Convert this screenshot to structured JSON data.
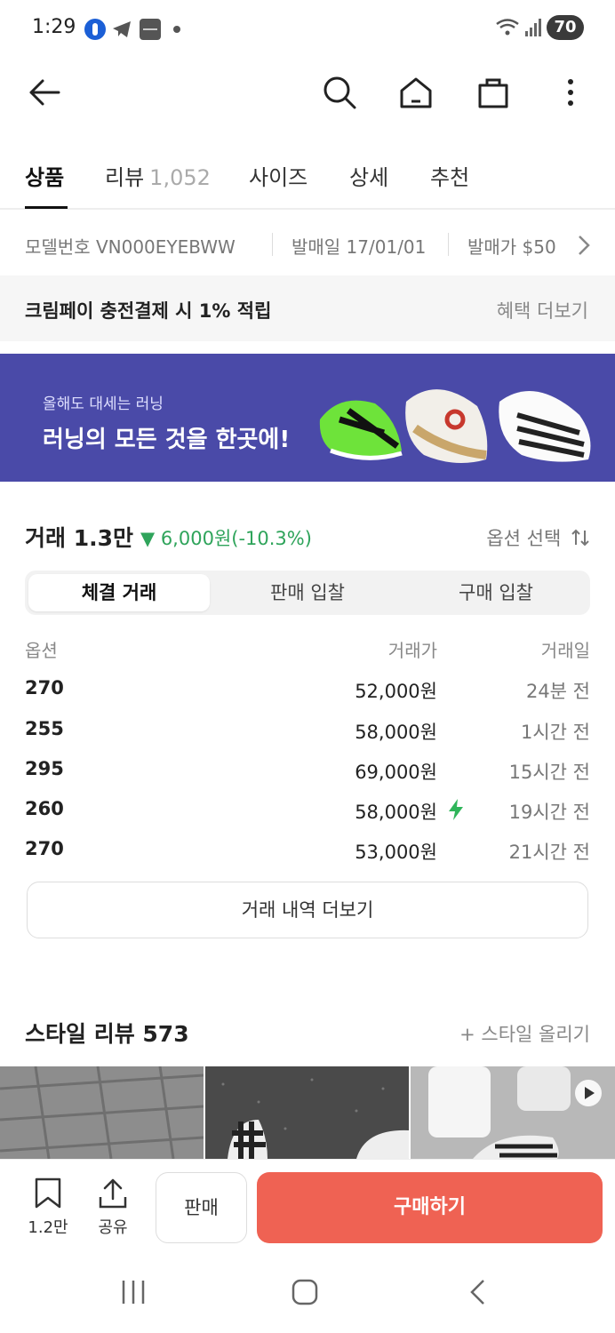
{
  "status_bar": {
    "time": "1:29",
    "battery": "70"
  },
  "tabs": [
    {
      "label": "상품",
      "count": ""
    },
    {
      "label": "리뷰",
      "count": "1,052"
    },
    {
      "label": "사이즈",
      "count": ""
    },
    {
      "label": "상세",
      "count": ""
    },
    {
      "label": "추천",
      "count": ""
    }
  ],
  "info": {
    "model": "모델번호 VN000EYEBWW",
    "release_date": "발매일 17/01/01",
    "release_price": "발매가 $50"
  },
  "promo": {
    "text": "크림페이 충전결제 시 1% 적립",
    "link": "혜택 더보기"
  },
  "banner": {
    "subtitle": "올해도 대세는 러닝",
    "title": "러닝의 모든 것을 한곳에!"
  },
  "trade": {
    "title": "거래 1.3만",
    "change": "▼ 6,000원(-10.3%)",
    "option_select": "옵션 선택",
    "segments": [
      "체결 거래",
      "판매 입찰",
      "구매 입찰"
    ],
    "columns": {
      "option": "옵션",
      "price": "거래가",
      "date": "거래일"
    },
    "rows": [
      {
        "option": "270",
        "price": "52,000원",
        "date": "24분 전",
        "fast": false
      },
      {
        "option": "255",
        "price": "58,000원",
        "date": "1시간 전",
        "fast": false
      },
      {
        "option": "295",
        "price": "69,000원",
        "date": "15시간 전",
        "fast": false
      },
      {
        "option": "260",
        "price": "58,000원",
        "date": "19시간 전",
        "fast": true
      },
      {
        "option": "270",
        "price": "53,000원",
        "date": "21시간 전",
        "fast": false
      }
    ],
    "more_label": "거래 내역 더보기"
  },
  "style": {
    "title": "스타일 리뷰 573",
    "upload": "+ 스타일 올리기"
  },
  "action_bar": {
    "bookmark_count": "1.2만",
    "share_label": "공유",
    "sell_label": "판매",
    "buy_label": "구매하기"
  },
  "colors": {
    "accent_buy": "#ef6253",
    "price_down": "#2fa45b",
    "banner_bg": "#4a4aa8"
  }
}
